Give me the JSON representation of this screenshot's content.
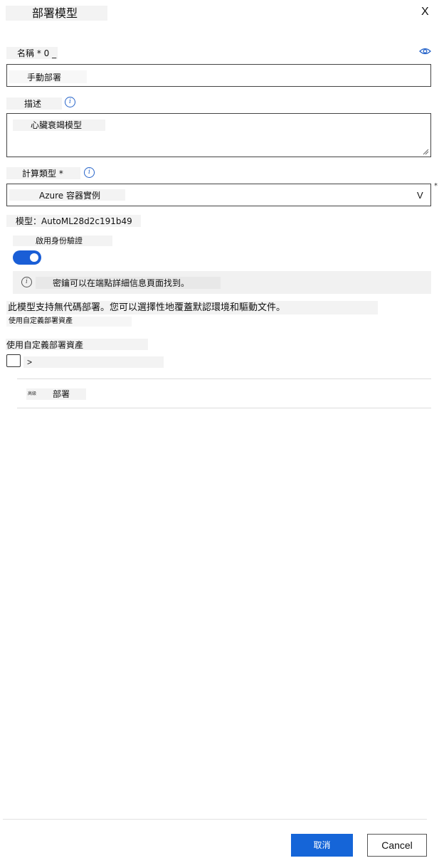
{
  "panel": {
    "title": "部署模型",
    "close_label": "X"
  },
  "name_field": {
    "label": "名稱 * 0 _",
    "value": "手動部署"
  },
  "description_field": {
    "label": "描述",
    "value": "心臟衰竭模型"
  },
  "compute_type_field": {
    "label": "計算類型 *",
    "value": "Azure 容器實例",
    "dropdown_glyph": "V",
    "required_mark": "*"
  },
  "model_line": "模型：AutoML28d2c191b49",
  "auth": {
    "label": "啟用身份驗證",
    "enabled": true
  },
  "info_bar": {
    "text": "密鑰可以在端點詳細信息頁面找到。"
  },
  "no_code_text": "此模型支持無代碼部署。您可以選擇性地覆蓋默認環境和驅動文件。",
  "custom_assets_small": "使用自定義部署資產",
  "custom_assets_label": "使用自定義部署資產",
  "advanced_row_chevron": ">",
  "section_row": {
    "prefix": "高級",
    "label": "部署"
  },
  "buttons": {
    "primary_label": "取消",
    "secondary_label": "Cancel"
  },
  "colors": {
    "accent": "#1565d8",
    "toggle_on": "#1a5ed6",
    "info_icon": "#2563c9",
    "label_bg": "#f3f3f3"
  }
}
